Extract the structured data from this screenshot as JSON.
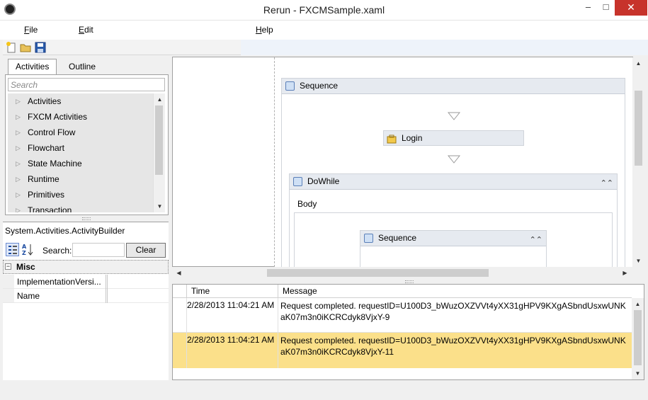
{
  "window": {
    "title": "Rerun - FXCMSample.xaml",
    "minimize_glyph": "–",
    "maximize_glyph": "□",
    "close_glyph": "✕"
  },
  "menu": {
    "file": {
      "accel": "F",
      "rest": "ile"
    },
    "edit": {
      "accel": "E",
      "rest": "dit"
    },
    "help": {
      "accel": "H",
      "rest": "elp"
    }
  },
  "toolbar": {
    "icons": [
      "new-file-icon",
      "open-folder-icon",
      "save-icon"
    ]
  },
  "toolbox": {
    "tabs": [
      "Activities",
      "Outline"
    ],
    "search_placeholder": "Search",
    "items": [
      "Activities",
      "FXCM Activities",
      "Control Flow",
      "Flowchart",
      "State Machine",
      "Runtime",
      "Primitives",
      "Transaction"
    ]
  },
  "properties": {
    "title": "System.Activities.ActivityBuilder",
    "search_label": "Search:",
    "clear_label": "Clear",
    "category": "Misc",
    "rows": [
      "ImplementationVersi...",
      "Name"
    ]
  },
  "designer": {
    "outer_sequence": "Sequence",
    "login": "Login",
    "dowhile": "DoWhile",
    "body_label": "Body",
    "inner_sequence": "Sequence"
  },
  "log": {
    "columns": [
      "Time",
      "Message"
    ],
    "rows": [
      {
        "time": "2/28/2013 11:04:21 AM",
        "message": "Request completed. requestID=U100D3_bWuzOXZVVt4yXX31gHPV9KXgASbndUsxwUNKaK07m3n0iKCRCdyk8VjxY-9"
      },
      {
        "time": "2/28/2013 11:04:21 AM",
        "message": "Request completed. requestID=U100D3_bWuzOXZVVt4yXX31gHPV9KXgASbndUsxwUNKaK07m3n0iKCRCdyk8VjxY-11"
      }
    ]
  },
  "colors": {
    "highlight_row": "#fbe08a",
    "close_button": "#c7332b"
  }
}
